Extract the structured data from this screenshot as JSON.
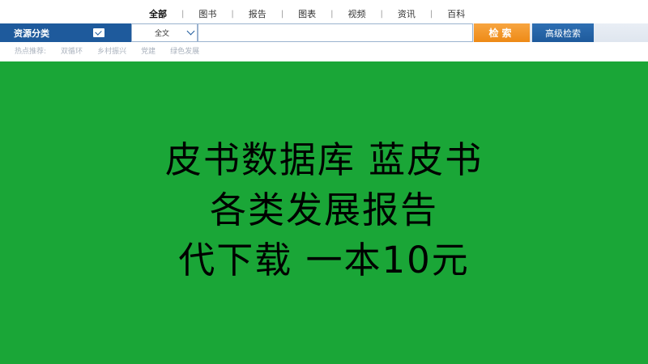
{
  "categories": [
    "全部",
    "图书",
    "报告",
    "图表",
    "视频",
    "资讯",
    "百科"
  ],
  "search": {
    "resource_category_label": "资源分类",
    "scope_value": "全文",
    "query_value": "",
    "search_button": "检索",
    "advanced_search_button": "高级检索"
  },
  "hot": {
    "label": "热点推荐:",
    "items": [
      "双循环",
      "乡村振兴",
      "党建",
      "绿色发展"
    ]
  },
  "banner": {
    "line1": "皮书数据库 蓝皮书",
    "line2": "各类发展报告",
    "line3": "代下载 一本10元"
  }
}
